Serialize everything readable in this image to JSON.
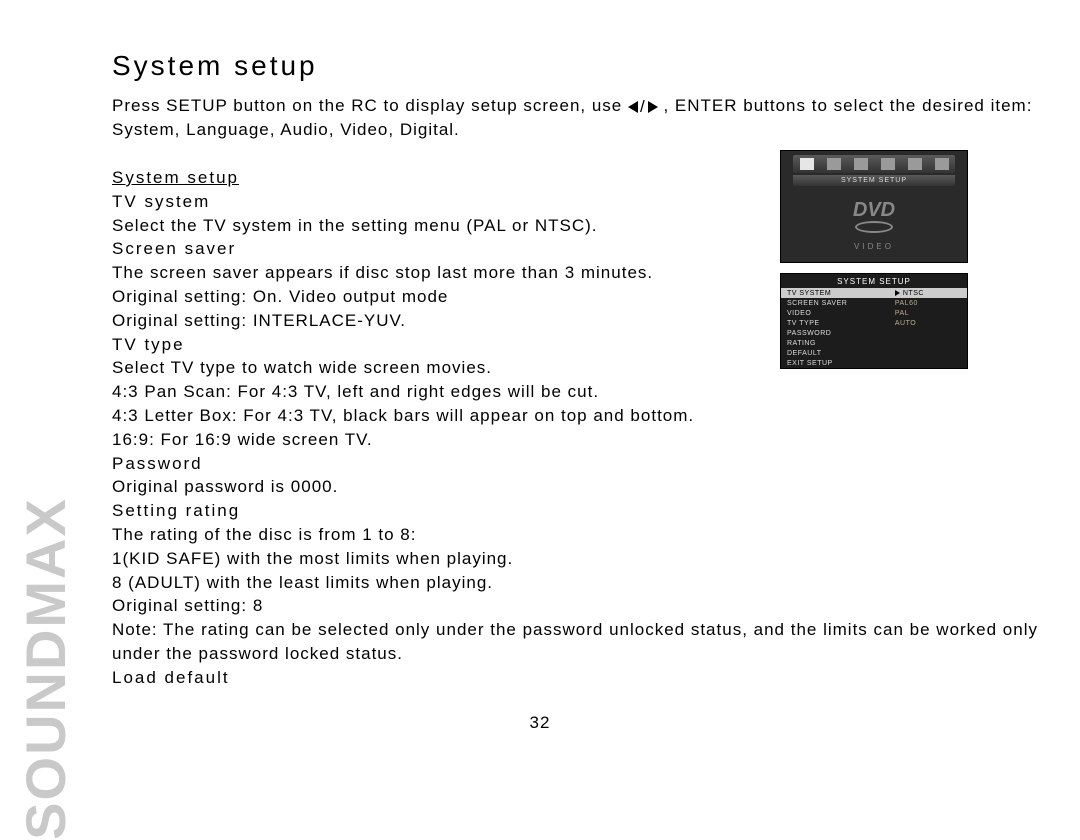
{
  "brand": "SOUNDMAX",
  "page_number": "32",
  "title": "System setup",
  "intro_a": "Press SETUP button on the RC to display setup screen, use ",
  "intro_b": ", ENTER buttons to select the desired item: System, Language, Audio, Video, Digital.",
  "section_heading": "System setup",
  "lines": {
    "tv_system_h": "TV system",
    "tv_system_t": "Select the TV system in the setting menu (PAL or NTSC).",
    "screen_saver_h": "Screen saver",
    "screen_saver_t1": "The screen saver appears if disc stop last more than 3 minutes.",
    "screen_saver_t2": "Original setting: On. Video output mode",
    "screen_saver_t3": "Original setting: INTERLACE-YUV.",
    "tv_type_h": "TV type",
    "tv_type_t1": "Select TV type to watch wide screen movies.",
    "tv_type_t2": "4:3 Pan Scan: For 4:3 TV, left and right edges will be cut.",
    "tv_type_t3": "4:3 Letter Box: For 4:3 TV, black bars will appear on top and bottom.",
    "tv_type_t4": "16:9: For 16:9 wide screen TV.",
    "password_h": "Password",
    "password_t": "Original password is 0000.",
    "rating_h": "Setting rating",
    "rating_t1": "The rating of the disc is from 1 to 8:",
    "rating_t2": "1(KID SAFE) with the most limits when playing.",
    "rating_t3": "8 (ADULT) with the least limits when playing.",
    "rating_t4": "Original setting: 8",
    "note": "Note: The rating can be selected only under the password unlocked status, and the limits can be worked only under the password locked status.",
    "load_default_h": "Load default"
  },
  "fig1": {
    "subbar": "SYSTEM SETUP",
    "dvd": "DVD",
    "video": "VIDEO"
  },
  "fig2": {
    "header": "SYSTEM SETUP",
    "left": [
      "TV SYSTEM",
      "SCREEN SAVER",
      "VIDEO",
      "TV TYPE",
      "PASSWORD",
      "RATING",
      "DEFAULT",
      "EXIT  SETUP"
    ],
    "right": [
      "NTSC",
      "PAL60",
      "PAL",
      "AUTO"
    ]
  }
}
